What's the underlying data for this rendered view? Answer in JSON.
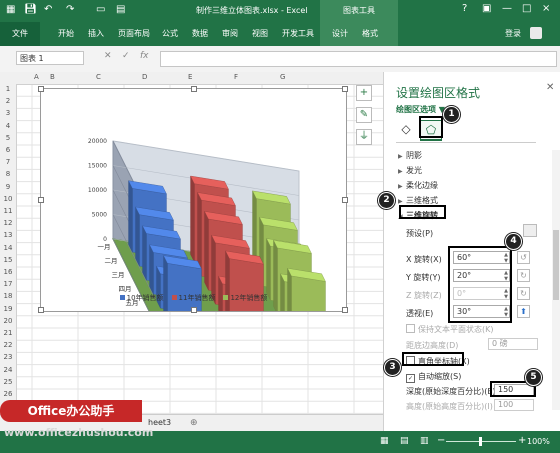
{
  "window": {
    "title": "制作三维立体图表.xlsx - Excel",
    "context_tools": "图表工具",
    "controls": {
      "help": "?",
      "restore": "▣",
      "minimize": "—",
      "maximize": "□",
      "close": "×"
    }
  },
  "ribbon": {
    "file": "文件",
    "tabs": [
      "开始",
      "插入",
      "页面布局",
      "公式",
      "数据",
      "审阅",
      "视图",
      "开发工具",
      "设计",
      "格式"
    ],
    "login": "登录"
  },
  "formula_bar": {
    "name_box": "图表 1",
    "cancel": "✕",
    "enter": "✓",
    "fx": "fx"
  },
  "columns": [
    "A",
    "B",
    "C",
    "D",
    "E",
    "F",
    "G"
  ],
  "rows": [
    "1",
    "2",
    "3",
    "4",
    "5",
    "6",
    "7",
    "8",
    "9",
    "10",
    "11",
    "12",
    "13",
    "14",
    "15",
    "16",
    "17",
    "18",
    "19",
    "20",
    "21",
    "22",
    "23",
    "24",
    "25",
    "26",
    "27"
  ],
  "chart_data": {
    "type": "bar",
    "style": "3d-column",
    "categories": [
      "一月",
      "二月",
      "三月",
      "四月",
      "五月",
      "六月"
    ],
    "series": [
      {
        "name": "10年销售额",
        "color": "#4472c4",
        "values": [
          13000,
          10500,
          9500,
          8500,
          7000,
          12000
        ]
      },
      {
        "name": "11年销售额",
        "color": "#c0504d",
        "values": [
          16000,
          15500,
          14500,
          12500,
          7000,
          15000
        ]
      },
      {
        "name": "12年销售额",
        "color": "#9bbb59",
        "values": [
          15000,
          12500,
          11000,
          13500,
          9500,
          13500
        ]
      }
    ],
    "y_ticks": [
      "0",
      "5000",
      "10000",
      "15000",
      "20000"
    ],
    "ylim": [
      0,
      20000
    ],
    "depth_labels": [
      "10年销售额",
      "11年销售额",
      "12年销售额"
    ],
    "legend_position": "bottom",
    "grid": true
  },
  "chart_side_buttons": {
    "add": "+",
    "style": "✎",
    "filter": "⏚"
  },
  "sheet_tab": "heet3",
  "status": {
    "zoom": "100%"
  },
  "pane": {
    "title": "设置绘图区格式",
    "options_label": "绘图区选项 ▼",
    "icons": {
      "fill": "◇",
      "effects": "⬠"
    },
    "sections": [
      "阴影",
      "发光",
      "柔化边缘",
      "三维格式",
      "三维旋转"
    ],
    "preset_label": "预设(P)",
    "x_rot": {
      "label": "X 旋转(X)",
      "value": "60°"
    },
    "y_rot": {
      "label": "Y 旋转(Y)",
      "value": "20°"
    },
    "z_rot": {
      "label": "Z 旋转(Z)",
      "value": "0°"
    },
    "perspective": {
      "label": "透视(E)",
      "value": "30°"
    },
    "keep_text_flat": "保持文本平面状态(K)",
    "distance_label": "距底边高度(D)",
    "distance_value": "0 磅",
    "right_angle_axes": "直角坐标轴(X)",
    "autoscale": "自动缩放(S)",
    "depth_label": "深度(原始深度百分比)(E)",
    "depth_value": "150",
    "height_label": "高度(原始高度百分比)(I)",
    "height_value": "100"
  },
  "callouts": [
    "1",
    "2",
    "3",
    "4",
    "5"
  ],
  "watermark": {
    "badge": "Office办公助手",
    "url": "www.officezhushou.com"
  }
}
